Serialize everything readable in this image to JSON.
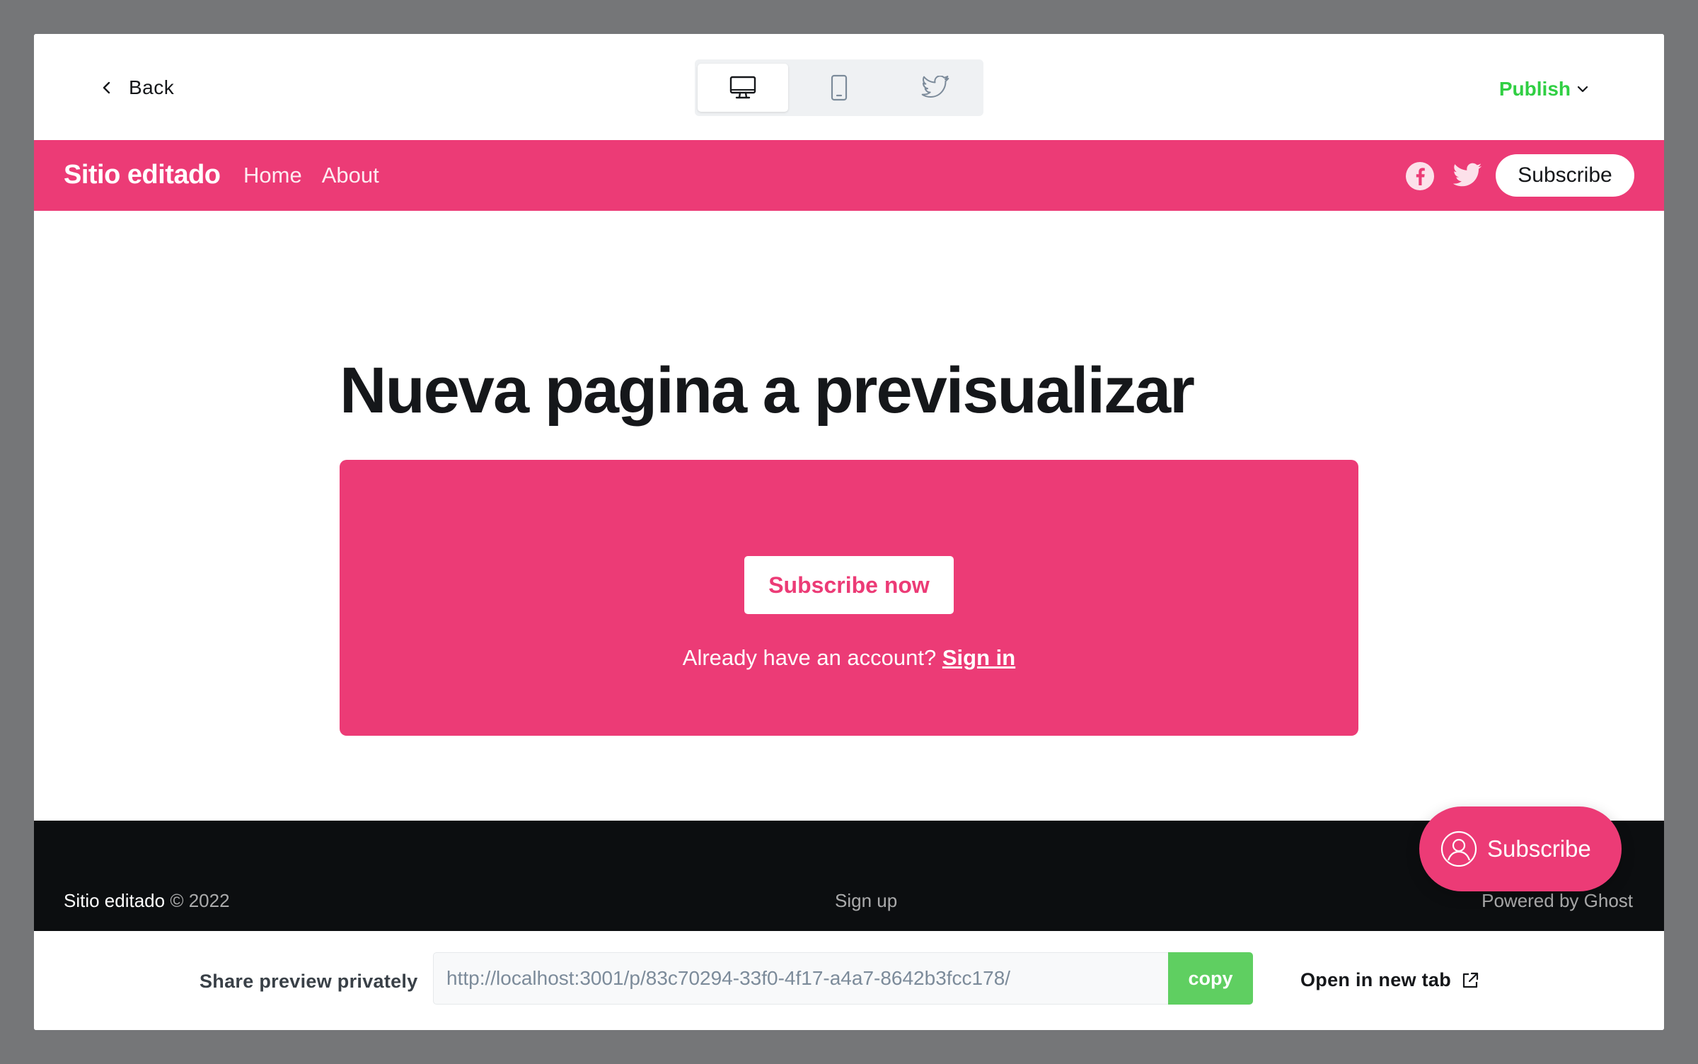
{
  "topbar": {
    "back_label": "Back",
    "devices": [
      "desktop-icon",
      "mobile-icon",
      "twitter-icon"
    ],
    "active_device": "desktop",
    "publish_label": "Publish"
  },
  "site": {
    "title": "Sitio editado",
    "nav": [
      "Home",
      "About"
    ],
    "subscribe_label": "Subscribe",
    "accent": "#ec3b76"
  },
  "page": {
    "title": "Nueva pagina a previsualizar",
    "cta": {
      "button_label": "Subscribe now",
      "account_text": "Already have an account?",
      "signin_label": "Sign in"
    }
  },
  "footer": {
    "site_name": "Sitio editado",
    "copyright": "© 2022",
    "signup": "Sign up",
    "powered": "Powered by Ghost"
  },
  "portal": {
    "label": "Subscribe"
  },
  "share": {
    "label": "Share preview privately",
    "url": "http://localhost:3001/p/83c70294-33f0-4f17-a4a7-8642b3fcc178/",
    "copy_label": "copy",
    "open_label": "Open in new tab",
    "copy_color": "#5fcf61",
    "publish_color": "#30cf43"
  }
}
